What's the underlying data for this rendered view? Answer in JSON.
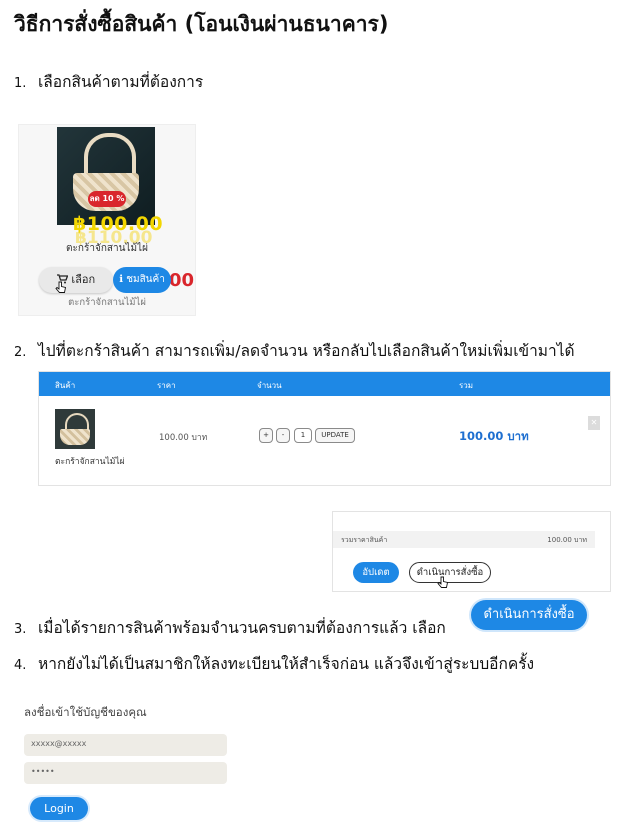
{
  "heading": "วิธีการสั่งซื้อสินค้า (โอนเงินผ่านธนาคาร)",
  "steps": [
    {
      "number": "1.",
      "text": "เลือกสินค้าตามที่ต้องการ"
    },
    {
      "number": "2.",
      "text": "ไปที่ตะกร้าสินค้า สามารถเพิ่ม/ลดจำนวน หรือกลับไปเลือกสินค้าใหม่เพิ่มเข้ามาได้"
    },
    {
      "number": "3.",
      "text": "เมื่อได้รายการสินค้าพร้อมจำนวนครบตามที่ต้องการแล้ว เลือก"
    },
    {
      "number": "4.",
      "text": "หากยังไม่ได้เป็นสมาชิกให้ลงทะเบียนให้สำเร็จก่อน แล้วจึงเข้าสู่ระบบอีกครั้ง"
    }
  ],
  "product_card": {
    "sale_badge": "ลด 10 %",
    "price_new": "฿100.00",
    "price_old": "฿110.00",
    "name": "ตะกร้าจักสานไม้ไผ่",
    "select_label": "เลือก",
    "view_label": "ชมสินค้า",
    "partial_price": "00",
    "name_below": "ตะกร้าจักสานไม้ไผ่",
    "icons": [
      "cart-icon",
      "info-icon",
      "pointer-cursor-icon"
    ]
  },
  "cart": {
    "headers": {
      "product": "สินค้า",
      "price": "ราคา",
      "quantity": "จำนวน",
      "total": "รวม"
    },
    "item": {
      "name": "ตะกร้าจักสานไม้ไผ่",
      "price": "100.00 บาท",
      "plus": "+",
      "minus": "-",
      "quantity": "1",
      "update": "UPDATE",
      "total": "100.00 บาท"
    },
    "accent_color": "#1e88e5"
  },
  "summary": {
    "label": "รวมราคาสินค้า",
    "amount": "100.00 บาท",
    "update_label": "อัปเดต",
    "checkout_label": "ดำเนินการสั่งซื้อ"
  },
  "checkout_button": "ดำเนินการสั่งซื้อ",
  "login": {
    "title": "ลงชื่อเข้าใช้บัญชีของคุณ",
    "email_value": "xxxxx@xxxxx",
    "password_value": "•••••",
    "login_label": "Login"
  }
}
